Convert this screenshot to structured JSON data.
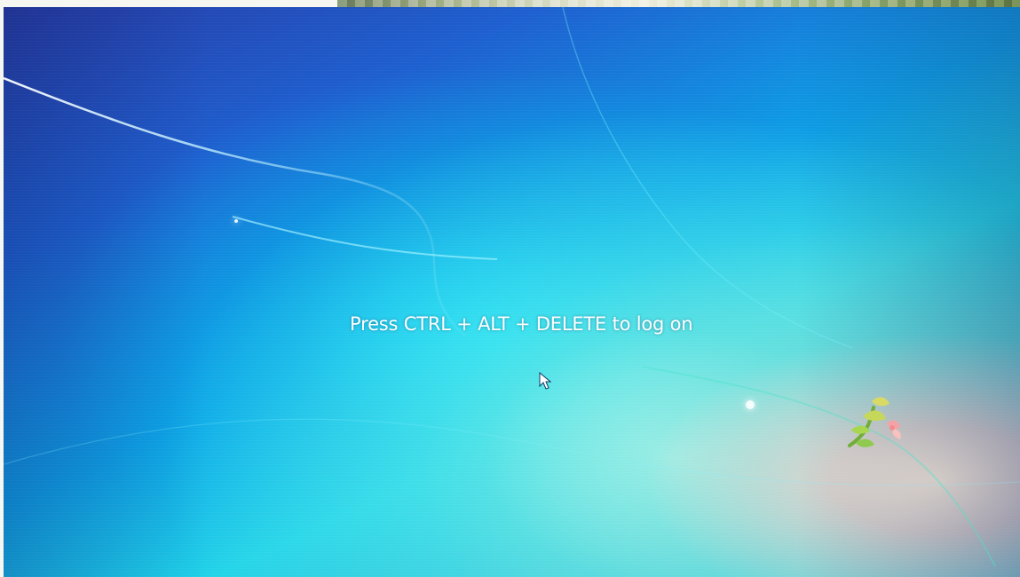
{
  "login_screen": {
    "prompt": "Press CTRL + ALT + DELETE to log on",
    "colors": {
      "primary_blue": "#1d5fd0",
      "cyan_glow": "#1fd3e8",
      "text": "#ffffff"
    },
    "icons": {
      "cursor": "mouse-cursor-icon",
      "wallpaper_mark": "windows-flower-logo-icon"
    }
  }
}
